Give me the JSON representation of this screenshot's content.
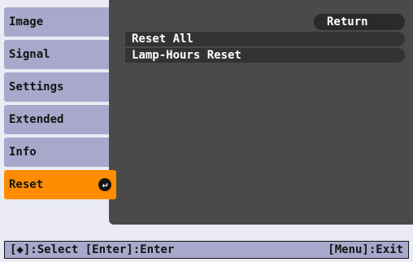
{
  "sidebar": {
    "items": [
      {
        "label": "Image"
      },
      {
        "label": "Signal"
      },
      {
        "label": "Settings"
      },
      {
        "label": "Extended"
      },
      {
        "label": "Info"
      },
      {
        "label": "Reset"
      }
    ],
    "active_index": 5
  },
  "main": {
    "return_label": "Return",
    "rows": [
      {
        "label": "Reset All"
      },
      {
        "label": "Lamp-Hours Reset"
      }
    ]
  },
  "footer": {
    "left_text": "[◆]:Select [Enter]:Enter",
    "right_text": "[Menu]:Exit"
  },
  "colors": {
    "sidebar_bg": "#a8a8cc",
    "active_bg": "#ff8c00",
    "panel_bg": "#4a4a4a"
  }
}
